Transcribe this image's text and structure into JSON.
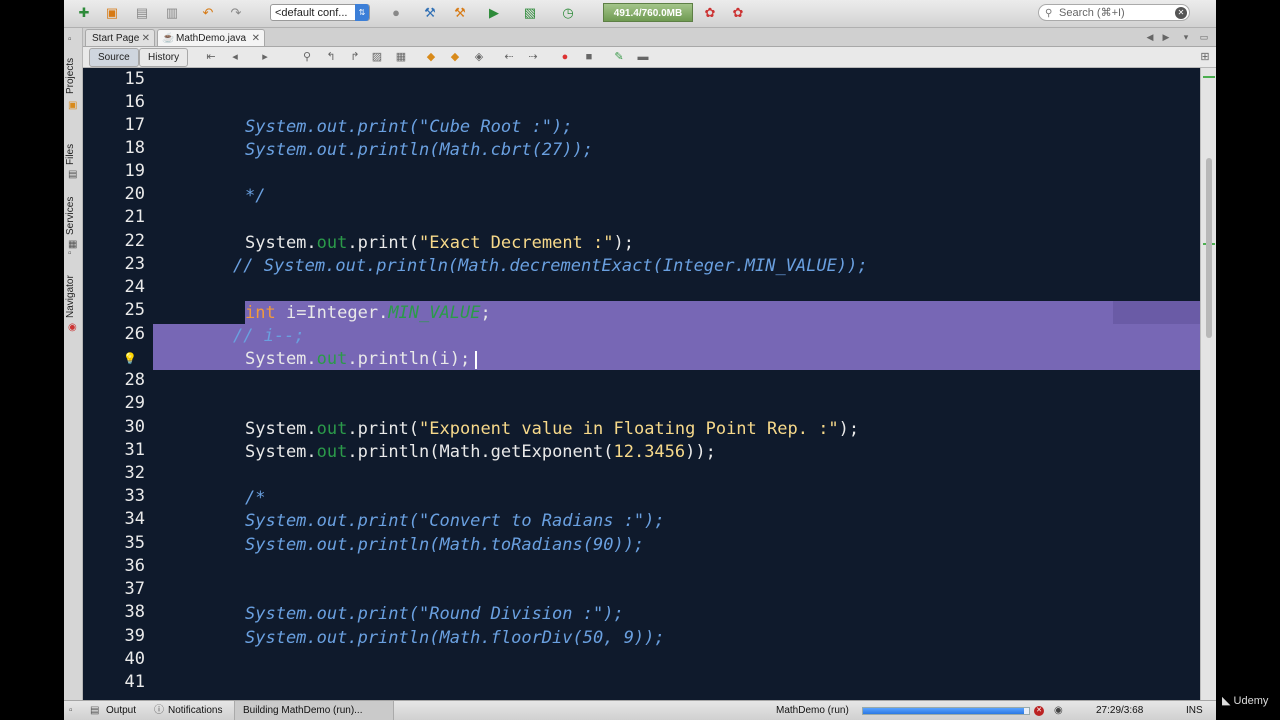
{
  "toolbar": {
    "config_label": "<default conf...",
    "memory_label": "491.4/760.0MB",
    "search_placeholder": "Search (⌘+I)"
  },
  "side_tabs": [
    "Projects",
    "Files",
    "Services",
    "Navigator"
  ],
  "tabs": [
    {
      "label": "Start Page",
      "active": false
    },
    {
      "label": "MathDemo.java",
      "active": true
    }
  ],
  "editor_toolbar": {
    "source_label": "Source",
    "history_label": "History"
  },
  "code": {
    "line_numbers": [
      "15",
      "16",
      "17",
      "18",
      "19",
      "20",
      "21",
      "22",
      "23",
      "24",
      "25",
      "26",
      "",
      "28",
      "29",
      "30",
      "31",
      "32",
      "33",
      "34",
      "35",
      "36",
      "37",
      "38",
      "39",
      "40",
      "41"
    ],
    "l17": "System.out.print(\"Cube Root :\");",
    "l18": "System.out.println(Math.cbrt(27));",
    "l20": "*/",
    "l22_a": "System.",
    "l22_b": "out",
    "l22_c": ".print(",
    "l22_d": "\"Exact Decrement :\"",
    "l22_e": ");",
    "l23": "// System.out.println(Math.decrementExact(Integer.MIN_VALUE));",
    "l25_a": "int",
    "l25_b": " i=Integer.",
    "l25_c": "MIN_VALUE",
    "l25_d": ";",
    "l26": "// i--;",
    "l27_a": "System.",
    "l27_b": "out",
    "l27_c": ".println(i);",
    "l30_a": "System.",
    "l30_b": "out",
    "l30_c": ".print(",
    "l30_d": "\"Exponent value in Floating Point Rep. :\"",
    "l30_e": ");",
    "l31_a": "System.",
    "l31_b": "out",
    "l31_c": ".println(Math.getExponent(",
    "l31_d": "12.3456",
    "l31_e": "));",
    "l33": "/*",
    "l34": "System.out.print(\"Convert to Radians :\");",
    "l35": "System.out.println(Math.toRadians(90));",
    "l38": "System.out.print(\"Round Division :\");",
    "l39": "System.out.println(Math.floorDiv(50, 9));"
  },
  "status": {
    "output_label": "Output",
    "notifications_label": "Notifications",
    "building_label": "Building MathDemo (run)...",
    "run_label": "MathDemo (run)",
    "progress": 0.97,
    "position": "27:29/3:68",
    "mode": "INS"
  },
  "watermark": "Udemy"
}
